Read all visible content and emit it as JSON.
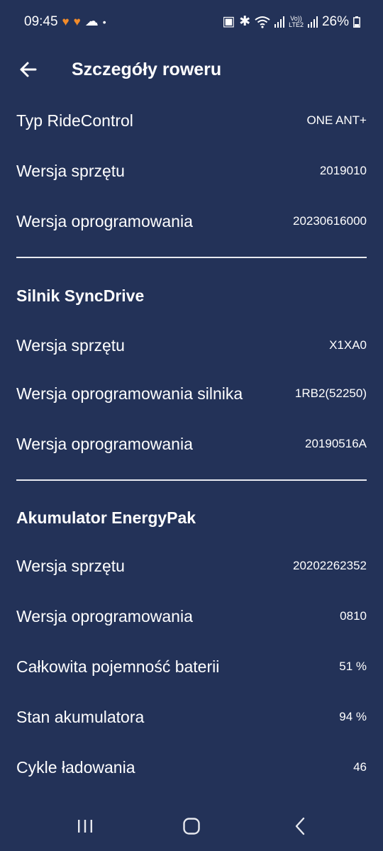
{
  "status": {
    "time": "09:45",
    "battery": "26%",
    "lte_top": "Vo))",
    "lte_bottom": "LTE2"
  },
  "header": {
    "title": "Szczegóły roweru"
  },
  "ridecontrol": {
    "type_label": "Typ RideControl",
    "type_value": "ONE ANT+",
    "hw_label": "Wersja sprzętu",
    "hw_value": "2019010",
    "fw_label": "Wersja oprogramowania",
    "fw_value": "20230616000"
  },
  "motor": {
    "title": "Silnik SyncDrive",
    "hw_label": "Wersja sprzętu",
    "hw_value": "X1XA0",
    "motor_fw_label": "Wersja oprogramowania silnika",
    "motor_fw_value": "1RB2(52250)",
    "fw_label": "Wersja oprogramowania",
    "fw_value": "20190516A"
  },
  "battery": {
    "title": "Akumulator EnergyPak",
    "hw_label": "Wersja sprzętu",
    "hw_value": "20202262352",
    "fw_label": "Wersja oprogramowania",
    "fw_value": "0810",
    "capacity_label": "Całkowita pojemność baterii",
    "capacity_value": "51 %",
    "health_label": "Stan akumulatora",
    "health_value": "94 %",
    "cycles_label": "Cykle ładowania",
    "cycles_value": "46"
  },
  "colors": {
    "background": "#233258",
    "text": "#ffffff",
    "accent": "#f28b2a"
  }
}
